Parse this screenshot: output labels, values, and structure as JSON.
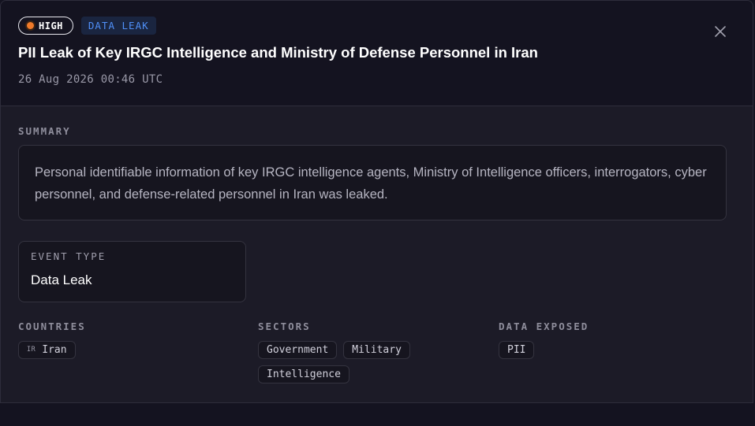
{
  "header": {
    "severity": "HIGH",
    "type_badge": "DATA LEAK",
    "title": "PII Leak of Key IRGC Intelligence and Ministry of Defense Personnel in Iran",
    "timestamp": "26 Aug 2026 00:46 UTC",
    "close_icon": "close-icon",
    "severity_color": "#f07a2a",
    "type_color": "#4f8ff7"
  },
  "summary": {
    "label": "SUMMARY",
    "text": "Personal identifiable information of key IRGC intelligence agents, Ministry of Intelligence officers, interrogators, cyber personnel, and defense-related personnel in Iran was leaked."
  },
  "event_type": {
    "label": "EVENT TYPE",
    "value": "Data Leak"
  },
  "countries": {
    "label": "COUNTRIES",
    "items": [
      {
        "code": "IR",
        "name": "Iran"
      }
    ]
  },
  "sectors": {
    "label": "SECTORS",
    "items": [
      "Government",
      "Military",
      "Intelligence"
    ]
  },
  "data_exposed": {
    "label": "DATA EXPOSED",
    "items": [
      "PII"
    ]
  }
}
